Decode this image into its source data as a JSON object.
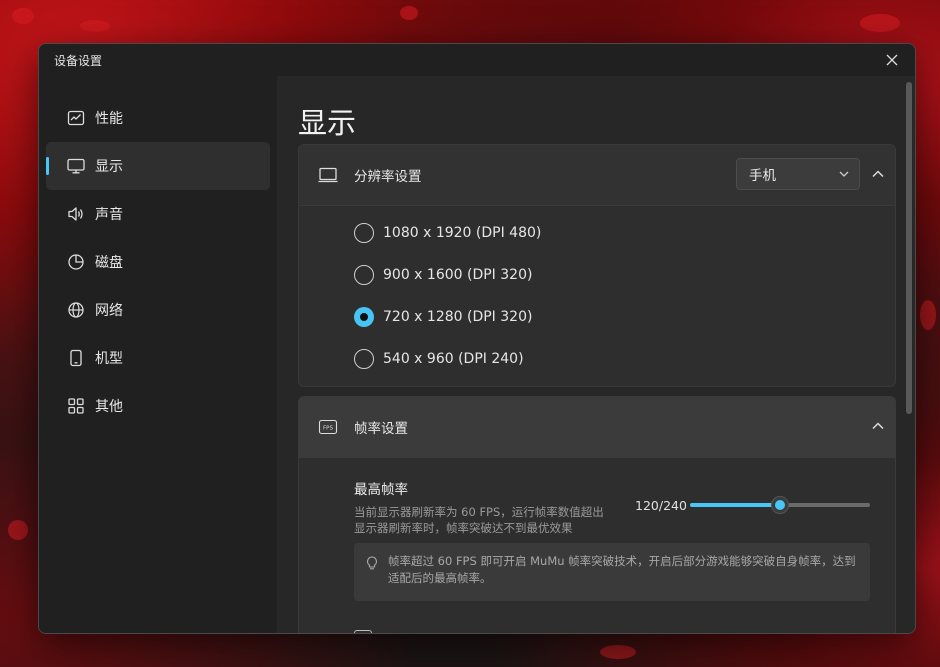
{
  "window": {
    "title": "设备设置"
  },
  "sidebar": {
    "items": [
      {
        "label": "性能",
        "icon": "chart-icon",
        "active": false
      },
      {
        "label": "显示",
        "icon": "monitor-icon",
        "active": true
      },
      {
        "label": "声音",
        "icon": "speaker-icon",
        "active": false
      },
      {
        "label": "磁盘",
        "icon": "pie-icon",
        "active": false
      },
      {
        "label": "网络",
        "icon": "globe-icon",
        "active": false
      },
      {
        "label": "机型",
        "icon": "phone-icon",
        "active": false
      },
      {
        "label": "其他",
        "icon": "grid-icon",
        "active": false
      }
    ]
  },
  "main": {
    "title": "显示",
    "resolution": {
      "heading": "分辨率设置",
      "device_select": "手机",
      "options": [
        {
          "label": "1080 x 1920 (DPI 480)",
          "selected": false
        },
        {
          "label": "900 x 1600 (DPI 320)",
          "selected": false
        },
        {
          "label": "720 x 1280 (DPI 320)",
          "selected": true
        },
        {
          "label": "540 x 960 (DPI 240)",
          "selected": false
        }
      ]
    },
    "fps": {
      "heading": "帧率设置",
      "fps_badge": "FPS",
      "max_label": "最高帧率",
      "description": "当前显示器刷新率为 60 FPS，运行帧率数值超出显示器刷新率时，帧率突破达不到最优效果",
      "value_text": "120/240",
      "value": 120,
      "max": 240,
      "tip": "帧率超过 60 FPS 即可开启 MuMu 帧率突破技术，开启后部分游戏能够突破自身帧率，达到适配后的最高帧率。"
    }
  },
  "colors": {
    "accent": "#47c7f5",
    "window_bg": "#2b2b2b",
    "sidebar_bg": "#202020"
  }
}
